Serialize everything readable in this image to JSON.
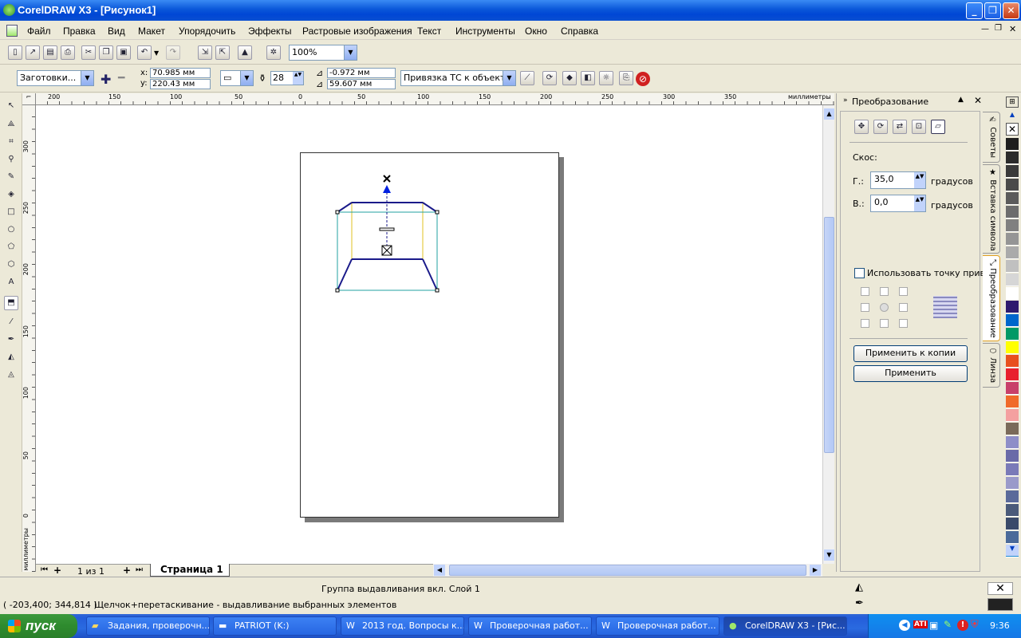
{
  "window": {
    "title": "CorelDRAW X3 - [Рисунок1]"
  },
  "menu": [
    "Файл",
    "Правка",
    "Вид",
    "Макет",
    "Упорядочить",
    "Эффекты",
    "Растровые изображения",
    "Текст",
    "Инструменты",
    "Окно",
    "Справка"
  ],
  "toolbar": {
    "zoom": "100%"
  },
  "propbar": {
    "presets": "Заготовки...",
    "x": "70.985 мм",
    "y": "220.43 мм",
    "depth": "28",
    "vp_x": "-0.972 мм",
    "vp_y": "59.607 мм",
    "vp_lock": "Привязка ТС к объекту",
    "x_label": "x:",
    "y_label": "y:"
  },
  "ruler": {
    "units": "миллиметры",
    "top_ticks": [
      "200",
      "150",
      "100",
      "50",
      "0",
      "50",
      "100",
      "150",
      "200",
      "250",
      "300",
      "350"
    ],
    "left_ticks": [
      "300",
      "250",
      "200",
      "150",
      "100",
      "50",
      "0"
    ]
  },
  "pagetabs": {
    "counter": "1 из 1",
    "page": "Страница 1"
  },
  "docker": {
    "title": "Преобразование",
    "section": "Скос:",
    "h_label": "Г.:",
    "h_value": "35,0",
    "v_label": "В.:",
    "v_value": "0,0",
    "unit": "градусов",
    "anchor_label": "Использовать точку привязки",
    "apply_copy": "Применить к копии",
    "apply": "Применить"
  },
  "docker_tabs": [
    "Советы",
    "Вставка символа",
    "Преобразование",
    "Линза"
  ],
  "palette": [
    "#1E1E1E",
    "#2B2B2B",
    "#3A3A3A",
    "#4A4A4A",
    "#5B5B5B",
    "#6C6C6C",
    "#808080",
    "#959595",
    "#AAAAAA",
    "#C0C0C0",
    "#D6D6D6",
    "#FFFFFF",
    "#2E1A6E",
    "#0066CC",
    "#009966",
    "#FFFF00",
    "#E8501E",
    "#E8202E",
    "#C8406A",
    "#F06A2A",
    "#F4A0A0",
    "#7A6A5A",
    "#8E8EC8",
    "#6A6AA8",
    "#7A7AB8",
    "#9A9ACA",
    "#5A6A9A",
    "#4A5A7A",
    "#3A4A6A",
    "#4A6A9A",
    "#1E88CC"
  ],
  "status": {
    "layer": "Группа выдавливания вкл. Слой 1",
    "coords": "( -203,400; 344,814 )",
    "hint": "Щелчок+перетаскивание - выдавливание выбранных элементов"
  },
  "taskbar": {
    "start": "пуск",
    "tasks": [
      "Задания, проверочн...",
      "PATRIOT (K:)",
      "2013 год. Вопросы к...",
      "Проверочная работ...",
      "Проверочная работ...",
      "CorelDRAW X3 - [Рис..."
    ],
    "lang": "RU",
    "clock": "9:36"
  }
}
